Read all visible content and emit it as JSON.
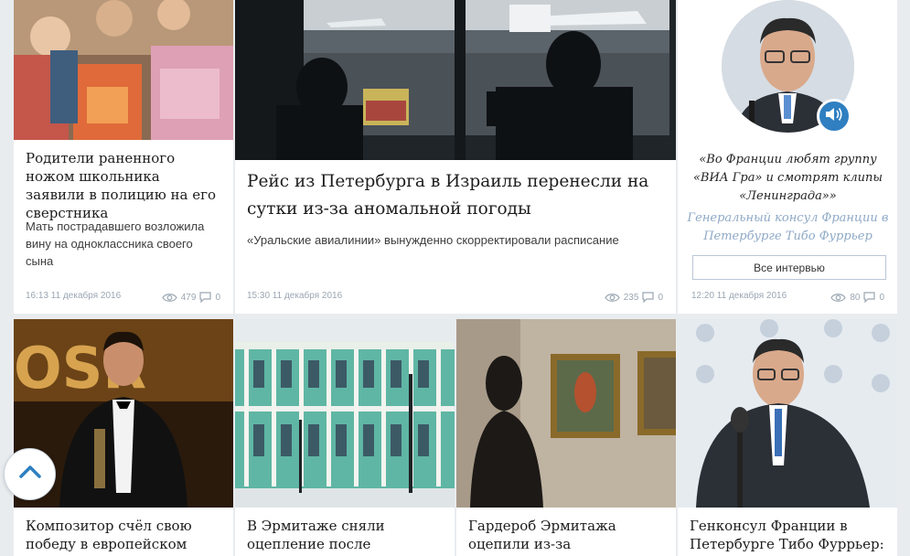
{
  "row1": {
    "card1": {
      "title": "Родители раненного ножом школьника заявили в полицию на его сверстника",
      "lead": "Мать пострадавшего возложила вину на одноклассника своего сына",
      "datetime": "16:13 11 декабря 2016",
      "views": "479",
      "comments": "0"
    },
    "card2": {
      "title": "Рейс из Петербурга в Израиль перенесли на сутки из-за аномальной погоды",
      "lead": "«Уральские авиалинии» вынужденно скорректировали расписание",
      "datetime": "15:30 11 декабря 2016",
      "views": "235",
      "comments": "0"
    },
    "interview": {
      "quote": "«Во Франции любят группу «ВИА Гра» и смотрят клипы «Ленинграда»»",
      "author": "Генеральный консул Франции в Петербурге Тибо Фуррьер",
      "button": "Все интервью",
      "datetime": "12:20 11 декабря 2016",
      "views": "80",
      "comments": "0"
    }
  },
  "row2": {
    "card1": {
      "title": "Композитор счёл свою победу в европейском"
    },
    "card2": {
      "title": "В Эрмитаже сняли оцепление после проверки"
    },
    "card3": {
      "title": "Гардероб Эрмитажа оцепили из-за подозрительного"
    },
    "card4": {
      "title": "Генконсул Франции в Петербурге Тибо Фуррьер: Во"
    }
  },
  "icons": {
    "views": "eye-icon",
    "comments": "comment-icon",
    "audio": "speaker-icon",
    "scroll": "chevron-up-icon"
  },
  "colors": {
    "accent": "#2f7fc1",
    "meta": "#9aa6b2",
    "author": "#8ea9c6"
  }
}
